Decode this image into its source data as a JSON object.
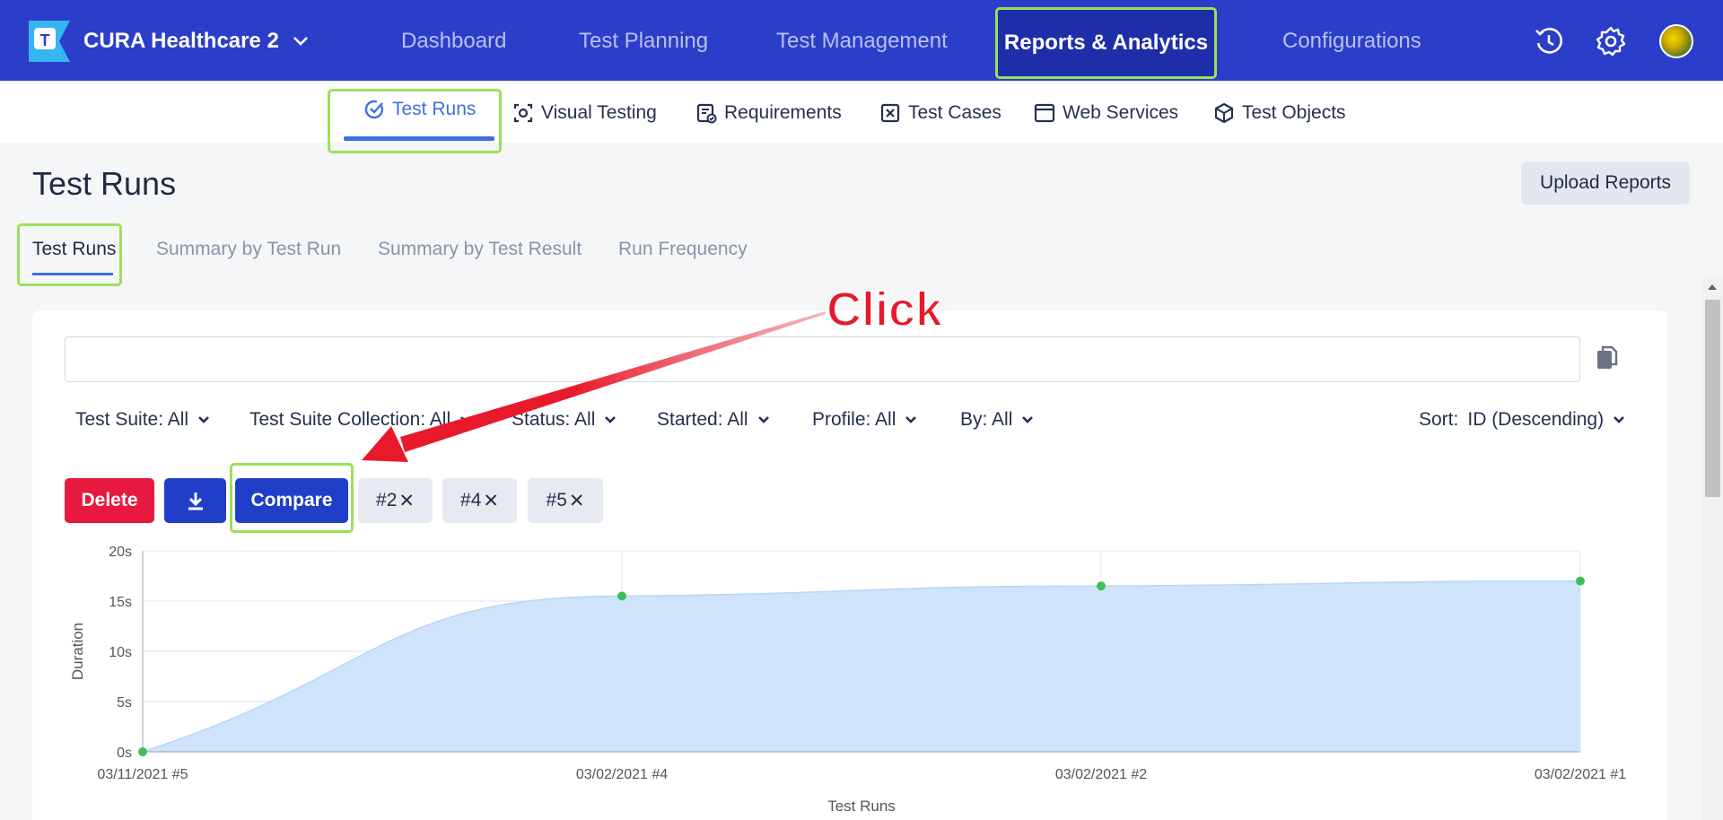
{
  "topbar": {
    "project_name": "CURA Healthcare 2",
    "logo_letter": "T",
    "nav": [
      "Dashboard",
      "Test Planning",
      "Test Management",
      "Reports & Analytics",
      "Configurations"
    ],
    "active_nav": "Reports & Analytics",
    "icons": [
      "history-icon",
      "gear-icon",
      "avatar"
    ]
  },
  "subnav": {
    "items": [
      {
        "label": "Test Runs",
        "icon": "check-circle-icon"
      },
      {
        "label": "Visual Testing",
        "icon": "camera-icon"
      },
      {
        "label": "Requirements",
        "icon": "checklist-icon"
      },
      {
        "label": "Test Cases",
        "icon": "test-case-icon"
      },
      {
        "label": "Web Services",
        "icon": "window-icon"
      },
      {
        "label": "Test Objects",
        "icon": "cube-icon"
      }
    ],
    "active": "Test Runs"
  },
  "page": {
    "title": "Test Runs",
    "upload_button": "Upload Reports",
    "tabs": [
      "Test Runs",
      "Summary by Test Run",
      "Summary by Test Result",
      "Run Frequency"
    ],
    "active_tab": "Test Runs"
  },
  "search": {
    "value": "",
    "placeholder": ""
  },
  "filters": [
    {
      "label": "Test Suite: All"
    },
    {
      "label": "Test Suite Collection: All"
    },
    {
      "label": "Status: All"
    },
    {
      "label": "Started: All"
    },
    {
      "label": "Profile: All"
    },
    {
      "label": "By: All"
    }
  ],
  "sort": {
    "prefix": "Sort:",
    "value": "ID (Descending)"
  },
  "actions": {
    "delete": "Delete",
    "compare": "Compare",
    "chips": [
      "#2",
      "#4",
      "#5"
    ]
  },
  "annotation": {
    "text": "Click",
    "color": "#e8192a"
  },
  "colors": {
    "brand": "#2b3ec9",
    "accent": "#3f6fe0",
    "highlight": "#9be05a",
    "danger": "#e8193f"
  },
  "chart_data": {
    "type": "area",
    "categories": [
      "03/11/2021 #5",
      "03/02/2021 #4",
      "03/02/2021 #2",
      "03/02/2021 #1"
    ],
    "series": [
      {
        "values": [
          0,
          15.5,
          16.5,
          17
        ]
      }
    ],
    "xlabel": "Test Runs",
    "ylabel": "Duration",
    "ylim": [
      0,
      20
    ],
    "yticks": [
      "0s",
      "5s",
      "10s",
      "15s",
      "20s"
    ],
    "grid": true
  }
}
